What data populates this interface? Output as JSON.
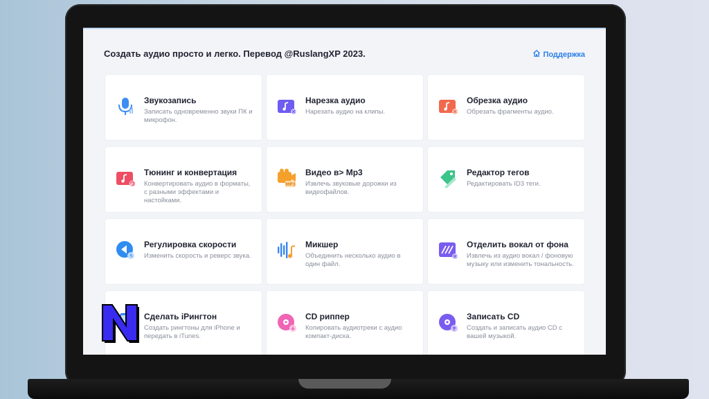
{
  "app": {
    "header_title": "Создать аудио просто и легко. Перевод @RuslangXP 2023.",
    "support_label": "Поддержка"
  },
  "cards": [
    {
      "title": "Звукозапись",
      "desc": "Записать одновременно звуки ПК и микрофон.",
      "icon": "microphone-icon"
    },
    {
      "title": "Нарезка аудио",
      "desc": "Нарезать аудио на клипы.",
      "icon": "audio-split-icon"
    },
    {
      "title": "Обрезка аудио",
      "desc": "Обрезать фрагменты аудио.",
      "icon": "audio-trim-icon"
    },
    {
      "title": "Тюнинг и конвертация",
      "desc": "Конвертировать аудио в форматы, с разными эффектами и настойками.",
      "icon": "audio-convert-icon"
    },
    {
      "title": "Видео в> Mp3",
      "desc": "Извлечь звуковые дорожки из видеофайлов.",
      "icon": "video-to-mp3-icon"
    },
    {
      "title": "Редактор тегов",
      "desc": "Редактировать ID3 теги.",
      "icon": "tag-edit-icon"
    },
    {
      "title": "Регулировка скорости",
      "desc": "Изменить скорость и реверс звука.",
      "icon": "speed-control-icon"
    },
    {
      "title": "Микшер",
      "desc": "Объединить несколько аудио в один файл.",
      "icon": "mixer-icon"
    },
    {
      "title": "Отделить вокал от фона",
      "desc": "Извлечь из аудио вокал / фоновую музыку или изменить тональность.",
      "icon": "vocal-remover-icon"
    },
    {
      "title": "Сделать iРингтон",
      "desc": "Создать рингтоны для iPhone и передать в iTunes.",
      "icon": "ringtone-icon"
    },
    {
      "title": "CD риппер",
      "desc": "Копировать аудиотреки с аудио компакт-диска.",
      "icon": "cd-ripper-icon"
    },
    {
      "title": "Записать CD",
      "desc": "Создать и записать аудио CD с вашей музыкой.",
      "icon": "cd-burn-icon"
    }
  ],
  "colors": {
    "accent": "#2b80e8",
    "screen_bg": "#f3f4f8",
    "card_bg": "#ffffff",
    "title_text": "#1f2230",
    "desc_text": "#8a8f9c"
  },
  "watermark": {
    "icon": "n-logo-icon"
  }
}
